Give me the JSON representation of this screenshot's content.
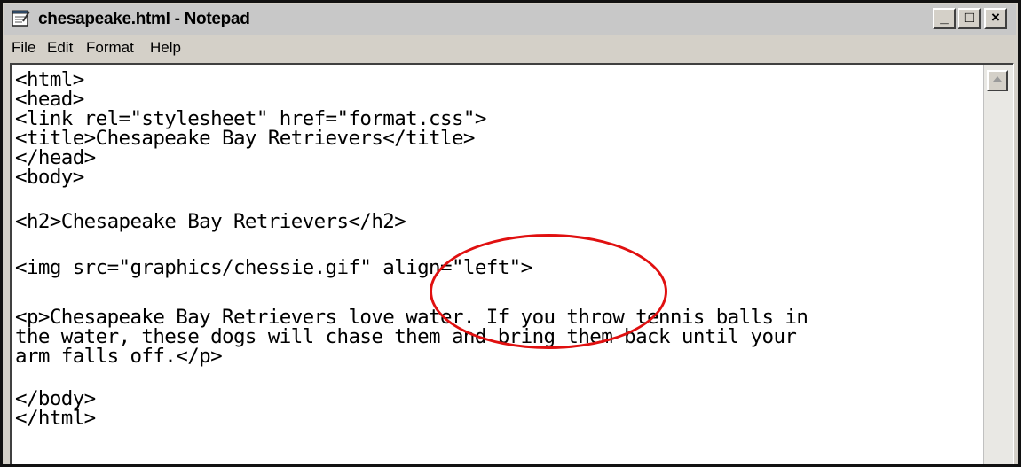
{
  "window": {
    "title": "chesapeake.html - Notepad",
    "controls": {
      "minimize": "_",
      "maximize": "□",
      "close": "×"
    }
  },
  "menu": [
    "File",
    "Edit",
    "Format",
    "Help"
  ],
  "editor": {
    "lines": [
      "<html>",
      "<head>",
      "<link rel=\"stylesheet\" href=\"format.css\">",
      "<title>Chesapeake Bay Retrievers</title>",
      "</head>",
      "<body>",
      "",
      "<h2>Chesapeake Bay Retrievers</h2>",
      "",
      "<img src=\"graphics/chessie.gif\" align=\"left\">",
      "",
      "<p>Chesapeake Bay Retrievers love water. If you throw tennis balls in",
      "the water, these dogs will chase them and bring them back until your",
      "arm falls off.</p>",
      "",
      "</body>",
      "</html>"
    ]
  },
  "colors": {
    "highlight": "#e01010"
  }
}
